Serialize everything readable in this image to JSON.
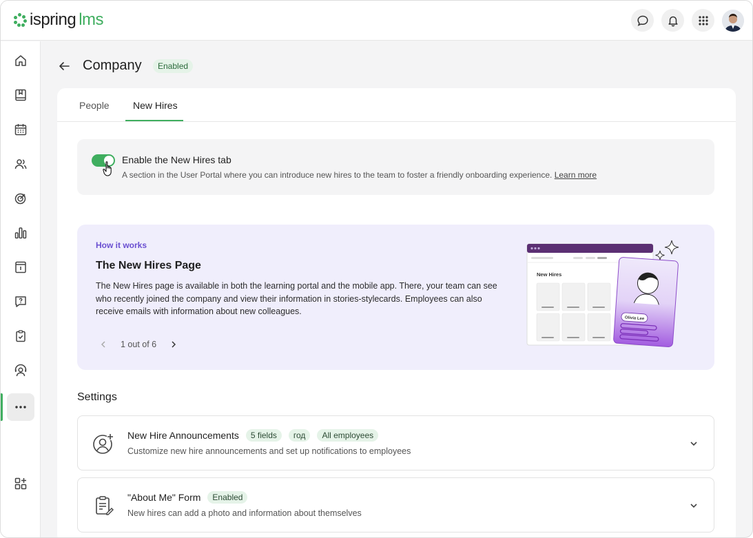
{
  "app": {
    "logo_text": "ispring",
    "logo_suffix": "lms"
  },
  "header": {
    "actions": [
      {
        "name": "chat-icon"
      },
      {
        "name": "bell-icon"
      },
      {
        "name": "apps-grid-icon"
      },
      {
        "name": "avatar"
      }
    ]
  },
  "sidebar": {
    "items": [
      {
        "icon": "home-icon"
      },
      {
        "icon": "book-icon"
      },
      {
        "icon": "calendar-icon"
      },
      {
        "icon": "users-icon"
      },
      {
        "icon": "target-icon"
      },
      {
        "icon": "bar-chart-icon"
      },
      {
        "icon": "info-card-icon"
      },
      {
        "icon": "question-chat-icon"
      },
      {
        "icon": "clipboard-check-icon"
      },
      {
        "icon": "support-agent-icon"
      },
      {
        "icon": "more-icon",
        "active": true
      },
      {
        "icon": "add-widget-icon"
      }
    ]
  },
  "page": {
    "title": "Company",
    "status": "Enabled"
  },
  "tabs": [
    {
      "label": "People",
      "active": false
    },
    {
      "label": "New Hires",
      "active": true
    }
  ],
  "toggle": {
    "enabled": true,
    "title": "Enable the New Hires tab",
    "description": "A section in the User Portal where you can introduce new hires to the team to foster a friendly onboarding experience.",
    "link": "Learn more"
  },
  "how_it_works": {
    "eyebrow": "How it works",
    "title": "The New Hires Page",
    "text": "The New Hires page is available in both the learning portal and the mobile app. There, your team can see who recently joined the company and view their information in stories-stylecards. Employees can also receive emails with information about new colleagues.",
    "pager": "1 out of 6",
    "illustration": {
      "panel_title": "New Hires",
      "card_name": "Olivia Lee"
    }
  },
  "settings": {
    "title": "Settings",
    "items": [
      {
        "name": "New Hire Announcements",
        "chips": [
          "5 fields",
          "год",
          "All employees"
        ],
        "description": "Customize new hire announcements and set up notifications to employees",
        "icon": "user-add-icon"
      },
      {
        "name": "\"About Me\" Form",
        "chips": [
          "Enabled"
        ],
        "description": "New hires can add a photo and information about themselves",
        "icon": "clipboard-edit-icon"
      }
    ]
  },
  "colors": {
    "accent": "#3fae5f",
    "purple": "#6a4fd1",
    "how_bg": "#f0eefc"
  }
}
